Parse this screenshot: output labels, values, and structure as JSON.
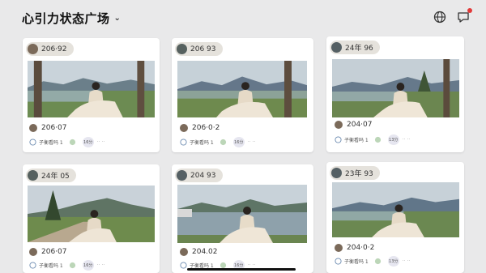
{
  "header": {
    "title": "心引力状态广场",
    "caret": "⌄"
  },
  "cards": [
    {
      "tag": "206·92",
      "author": "206·07",
      "caption": "子衡看吗 1",
      "badge": "16分",
      "extra": "·· ··"
    },
    {
      "tag": "206 93",
      "author": "206·0·2",
      "caption": "子衡看吗 1",
      "badge": "16分",
      "extra": "·· ··"
    },
    {
      "tag": "24年 96",
      "author": "204·07",
      "caption": "子衡看吗 1",
      "badge": "13分",
      "extra": "·· ··"
    },
    {
      "tag": "24年 05",
      "author": "206·07",
      "caption": "子衡看吗 1",
      "badge": "16分",
      "extra": "·· ··"
    },
    {
      "tag": "204 93",
      "author": "204.02",
      "caption": "子衡看吗 1",
      "badge": "16分",
      "extra": "·· ··"
    },
    {
      "tag": "23年 93",
      "author": "204·0·2",
      "caption": "子衡看吗 1",
      "badge": "13分",
      "extra": "·· ··"
    }
  ],
  "icons": {
    "globe": "globe-icon",
    "message": "message-icon",
    "bubble": "comment-icon",
    "leaf": "like-icon"
  },
  "colors": {
    "background": "#e9e9ea",
    "card": "#ffffff",
    "tag": "#e5e2dc",
    "notify": "#e23a3a"
  }
}
